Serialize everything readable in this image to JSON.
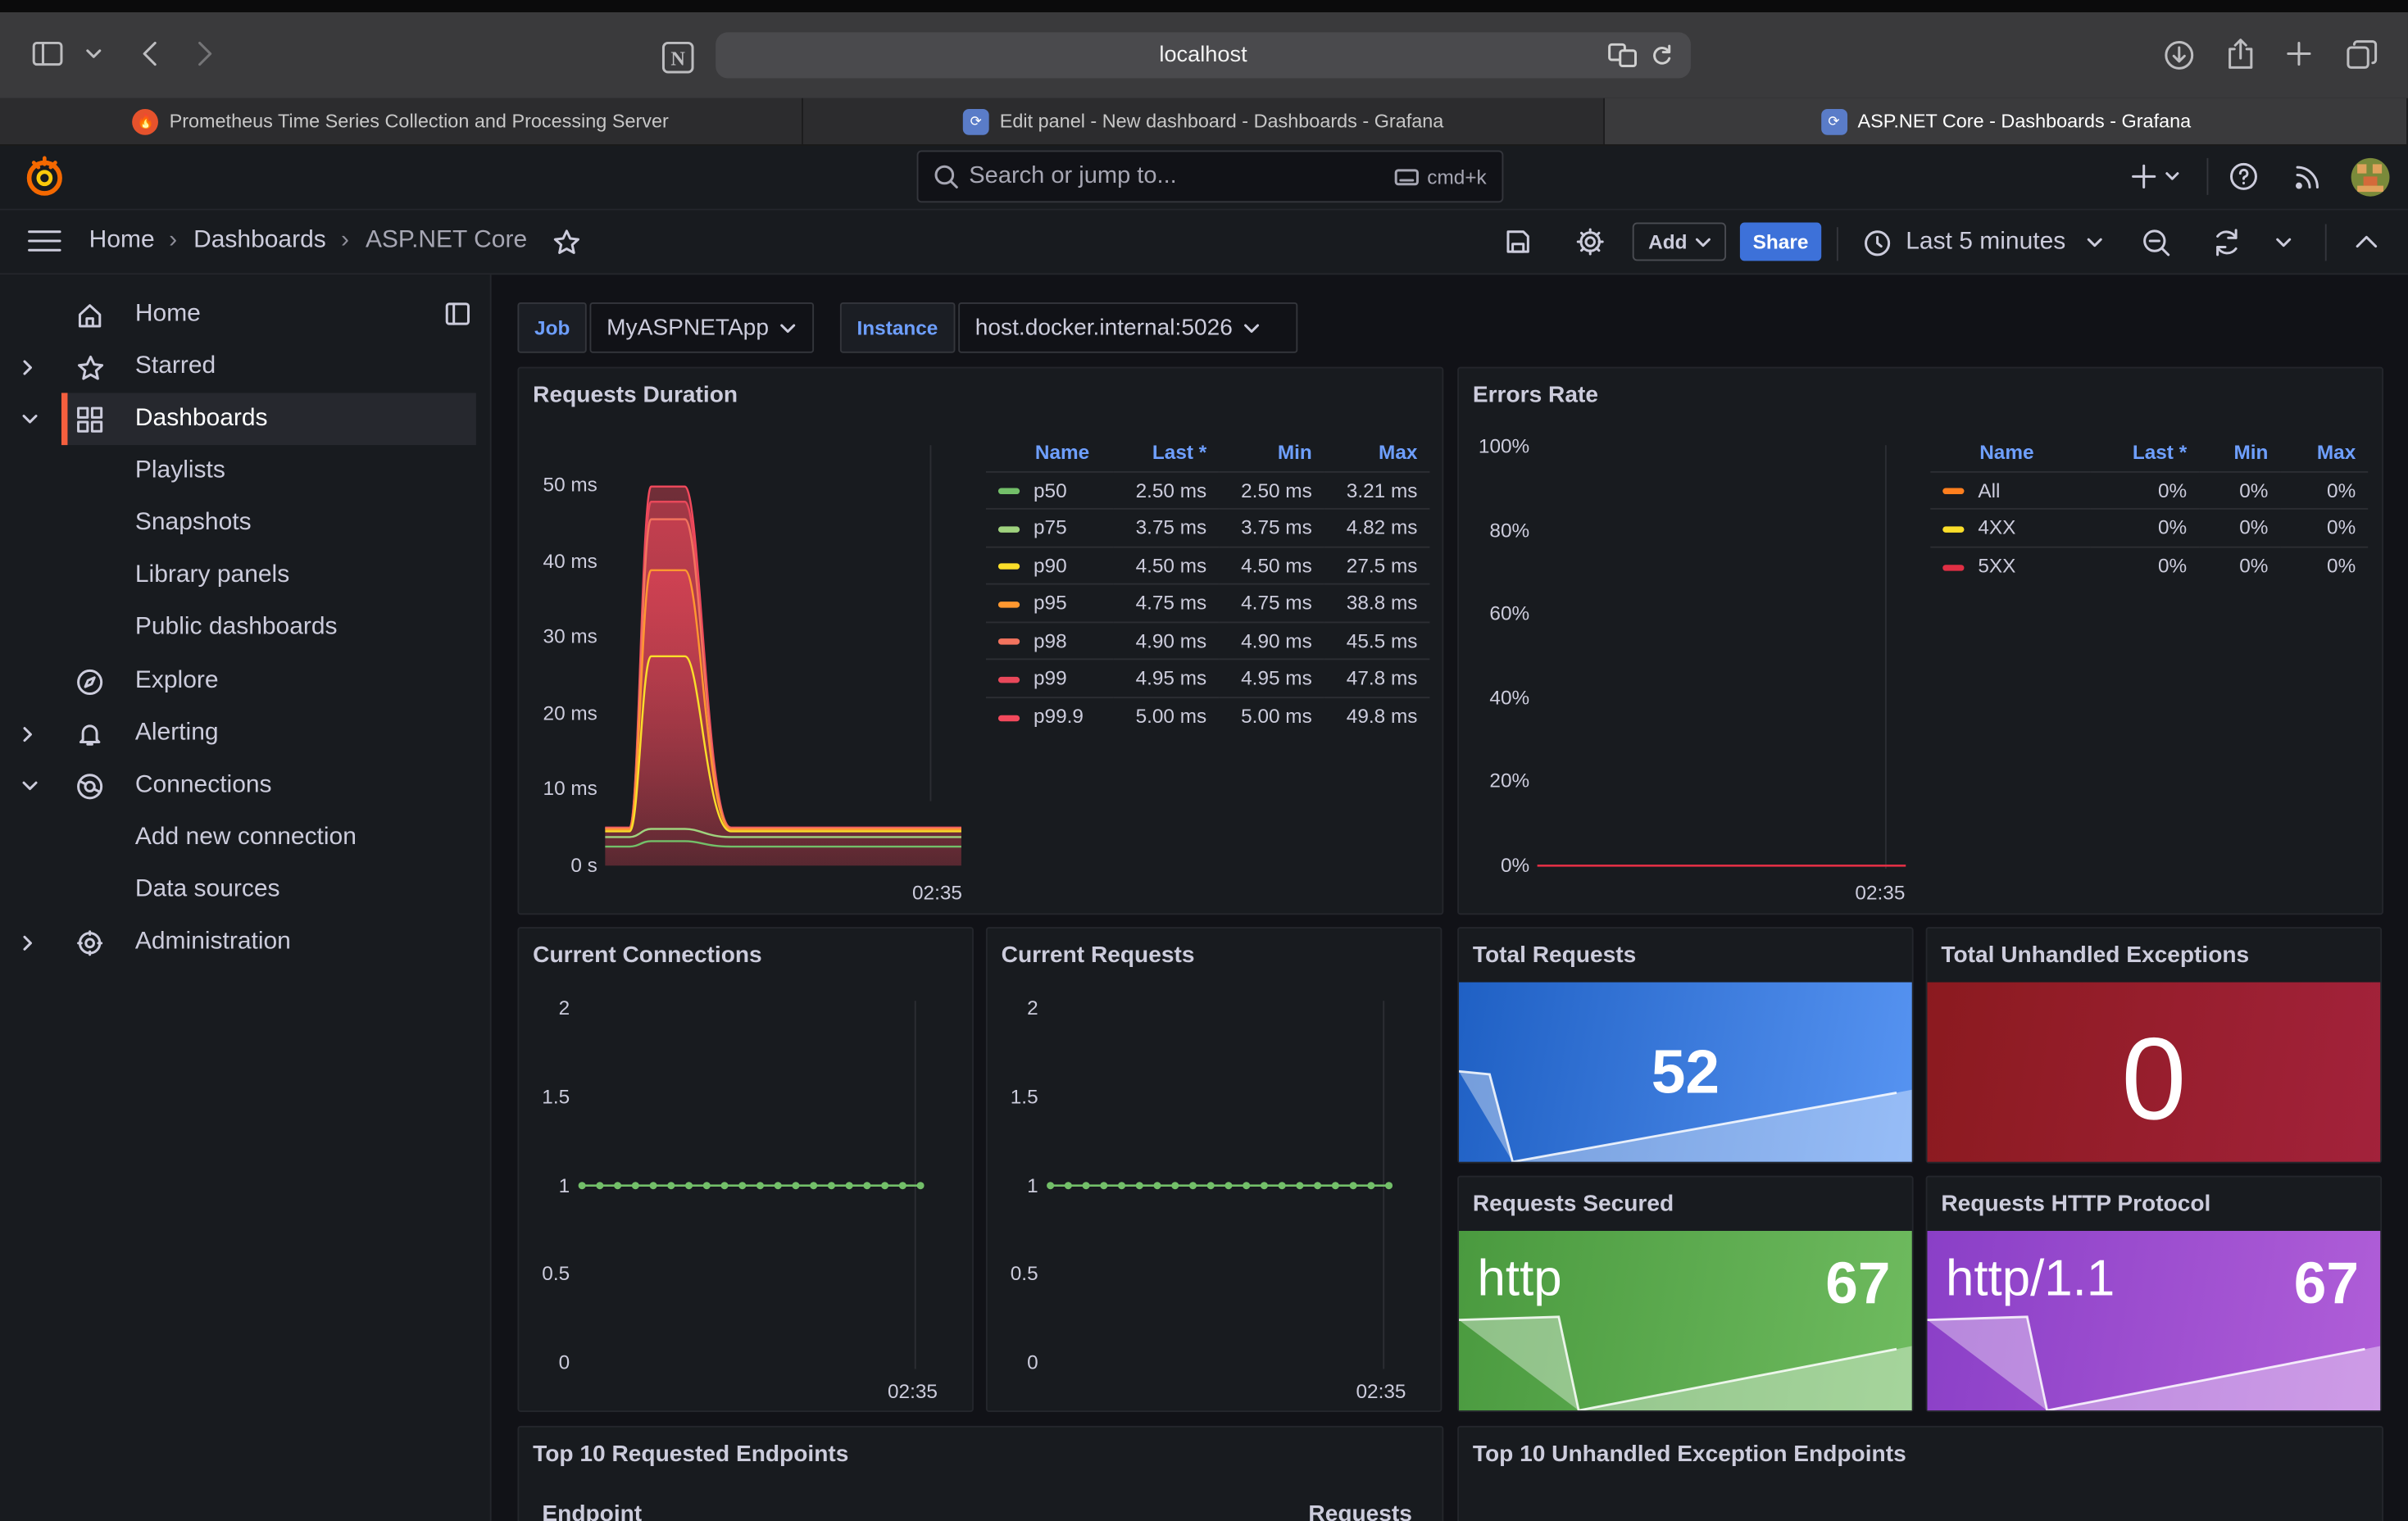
{
  "browser": {
    "url": "localhost",
    "tabs": [
      {
        "title": "Prometheus Time Series Collection and Processing Server",
        "icon": "prometheus-icon",
        "color": "#e6522c"
      },
      {
        "title": "Edit panel - New dashboard - Dashboards - Grafana",
        "icon": "grafana-icon",
        "color": "#5a7cc8"
      },
      {
        "title": "ASP.NET Core - Dashboards - Grafana",
        "icon": "grafana-icon",
        "color": "#5a7cc8"
      }
    ]
  },
  "topnav": {
    "search_placeholder": "Search or jump to...",
    "search_shortcut": "cmd+k"
  },
  "breadcrumb": [
    "Home",
    "Dashboards",
    "ASP.NET Core"
  ],
  "toolbar": {
    "add_label": "Add",
    "share_label": "Share",
    "time_range": "Last 5 minutes"
  },
  "sidebar": {
    "items": [
      {
        "label": "Home",
        "icon": "home-icon",
        "expandable": false
      },
      {
        "label": "Starred",
        "icon": "star-icon",
        "expandable": true
      },
      {
        "label": "Dashboards",
        "icon": "dashboards-icon",
        "expandable": true,
        "selected": true
      },
      {
        "label": "Playlists",
        "sub": true
      },
      {
        "label": "Snapshots",
        "sub": true
      },
      {
        "label": "Library panels",
        "sub": true
      },
      {
        "label": "Public dashboards",
        "sub": true
      },
      {
        "label": "Explore",
        "icon": "compass-icon"
      },
      {
        "label": "Alerting",
        "icon": "bell-icon",
        "expandable": true
      },
      {
        "label": "Connections",
        "icon": "connections-icon",
        "expandable": true
      },
      {
        "label": "Add new connection",
        "sub": true
      },
      {
        "label": "Data sources",
        "sub": true
      },
      {
        "label": "Administration",
        "icon": "gear-icon",
        "expandable": true
      }
    ]
  },
  "variables": {
    "job_label": "Job",
    "job_value": "MyASPNETApp",
    "instance_label": "Instance",
    "instance_value": "host.docker.internal:5026"
  },
  "panels": {
    "requests_duration": {
      "title": "Requests Duration",
      "legend_headers": [
        "Name",
        "Last *",
        "Min",
        "Max"
      ],
      "rows": [
        [
          "p50",
          "2.50 ms",
          "2.50 ms",
          "3.21 ms"
        ],
        [
          "p75",
          "3.75 ms",
          "3.75 ms",
          "4.82 ms"
        ],
        [
          "p90",
          "4.50 ms",
          "4.50 ms",
          "27.5 ms"
        ],
        [
          "p95",
          "4.75 ms",
          "4.75 ms",
          "38.8 ms"
        ],
        [
          "p98",
          "4.90 ms",
          "4.90 ms",
          "45.5 ms"
        ],
        [
          "p99",
          "4.95 ms",
          "4.95 ms",
          "47.8 ms"
        ],
        [
          "p99.9",
          "5.00 ms",
          "5.00 ms",
          "49.8 ms"
        ]
      ],
      "colors": [
        "#73bf69",
        "#9fd27e",
        "#fade2a",
        "#ff9830",
        "#f2735e",
        "#e8485a",
        "#f2495c"
      ],
      "yticks": [
        "50 ms",
        "40 ms",
        "30 ms",
        "20 ms",
        "10 ms",
        "0 s"
      ],
      "xtick": "02:35"
    },
    "errors_rate": {
      "title": "Errors Rate",
      "legend_headers": [
        "Name",
        "Last *",
        "Min",
        "Max"
      ],
      "rows": [
        [
          "All",
          "0%",
          "0%",
          "0%"
        ],
        [
          "4XX",
          "0%",
          "0%",
          "0%"
        ],
        [
          "5XX",
          "0%",
          "0%",
          "0%"
        ]
      ],
      "colors": [
        "#ff7f1e",
        "#fade2a",
        "#e02f44"
      ],
      "yticks": [
        "100%",
        "80%",
        "60%",
        "40%",
        "20%",
        "0%"
      ],
      "xtick": "02:35"
    },
    "current_connections": {
      "title": "Current Connections",
      "yticks": [
        "2",
        "1.5",
        "1",
        "0.5",
        "0"
      ],
      "xtick": "02:35",
      "value": 1
    },
    "current_requests": {
      "title": "Current Requests",
      "yticks": [
        "2",
        "1.5",
        "1",
        "0.5",
        "0"
      ],
      "xtick": "02:35",
      "value": 1
    },
    "total_requests": {
      "title": "Total Requests",
      "value": "52"
    },
    "total_exceptions": {
      "title": "Total Unhandled Exceptions",
      "value": "0"
    },
    "requests_secured": {
      "title": "Requests Secured",
      "label": "http",
      "value": "67"
    },
    "requests_protocol": {
      "title": "Requests HTTP Protocol",
      "label": "http/1.1",
      "value": "67"
    },
    "top_endpoints": {
      "title": "Top 10 Requested Endpoints",
      "col1": "Endpoint",
      "col2": "Requests"
    },
    "top_exceptions": {
      "title": "Top 10 Unhandled Exception Endpoints"
    }
  },
  "chart_data": [
    {
      "type": "line",
      "title": "Requests Duration",
      "ylabel": "",
      "ylim": [
        0,
        50
      ],
      "x_tick": "02:35",
      "series": [
        {
          "name": "p50",
          "values": [
            2.5,
            3.21,
            2.5
          ]
        },
        {
          "name": "p75",
          "values": [
            3.75,
            4.82,
            3.75
          ]
        },
        {
          "name": "p90",
          "values": [
            4.5,
            27.5,
            4.5
          ]
        },
        {
          "name": "p95",
          "values": [
            4.75,
            38.8,
            4.75
          ]
        },
        {
          "name": "p98",
          "values": [
            4.9,
            45.5,
            4.9
          ]
        },
        {
          "name": "p99",
          "values": [
            4.95,
            47.8,
            4.95
          ]
        },
        {
          "name": "p99.9",
          "values": [
            5.0,
            49.8,
            5.0
          ]
        }
      ]
    },
    {
      "type": "line",
      "title": "Errors Rate",
      "ylim": [
        0,
        100
      ],
      "series": [
        {
          "name": "All",
          "values": [
            0,
            0
          ]
        },
        {
          "name": "4XX",
          "values": [
            0,
            0
          ]
        },
        {
          "name": "5XX",
          "values": [
            0,
            0
          ]
        }
      ]
    },
    {
      "type": "line",
      "title": "Current Connections",
      "ylim": [
        0,
        2
      ],
      "series": [
        {
          "values": [
            1,
            1,
            1,
            1,
            1,
            1,
            1,
            1,
            1,
            1,
            1,
            1,
            1,
            1,
            1,
            1,
            1,
            1,
            1,
            1
          ]
        }
      ]
    },
    {
      "type": "line",
      "title": "Current Requests",
      "ylim": [
        0,
        2
      ],
      "series": [
        {
          "values": [
            1,
            1,
            1,
            1,
            1,
            1,
            1,
            1,
            1,
            1,
            1,
            1,
            1,
            1,
            1,
            1,
            1,
            1,
            1,
            1
          ]
        }
      ]
    }
  ]
}
